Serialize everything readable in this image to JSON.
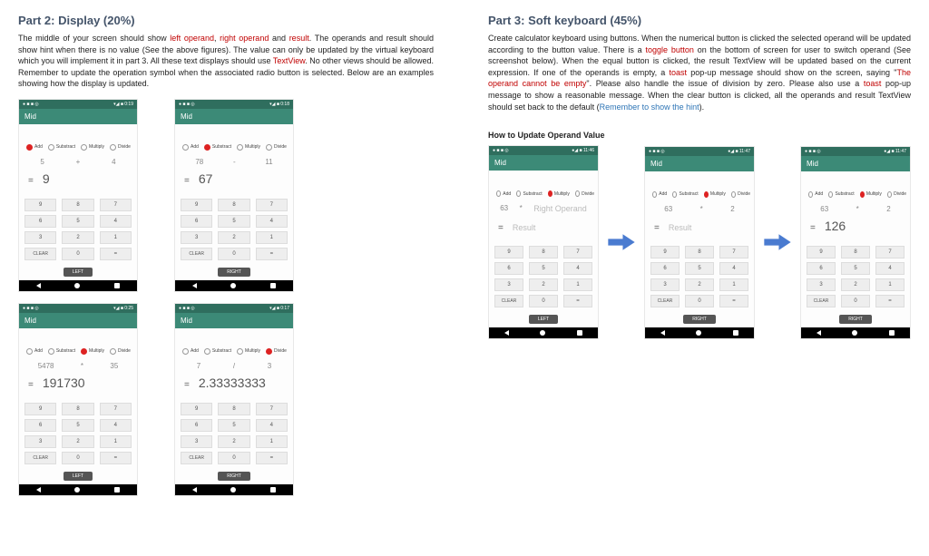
{
  "part2": {
    "title": "Part 2: Display (20%)",
    "text_plain": "The middle of your screen should show ",
    "red1": "left operand",
    "sep1": ", ",
    "red2": "right operand",
    "sep2": " and ",
    "red3": "result",
    "text_after": ". The operands and result should show hint when there is no value (See the above figures). The value can only be updated by the virtual keyboard which you will implement it in part 3. All these text displays should use ",
    "red4": "TextView",
    "text_end": ". No other views should be allowed. Remember to update the operation symbol when the associated radio button is selected. Below are an examples showing how the display is updated."
  },
  "part3": {
    "title": "Part 3: Soft keyboard (45%)",
    "t1": "Create calculator keyboard using buttons. When the numerical button is clicked the selected operand will be updated according to the button value. There is a ",
    "red1": "toggle button",
    "t2": " on the bottom of screen for user to switch operand (See screenshot below). When the equal button is clicked, the result TextView will be updated based on the current expression. If one of the operands is empty, a ",
    "red2": "toast",
    "t3": " pop-up message should show on the screen, saying \"",
    "red3": "The operand cannot be empty",
    "t4": "\". Please also handle the issue of division by zero. Please also use a ",
    "red4": "toast",
    "t5": " pop-up message to show a reasonable message. When the clear button is clicked, all the operands and result TextView should set back to the default (",
    "blue1": "Remember to show the hint",
    "t6": ")."
  },
  "sub_heading": "How to Update Operand Value",
  "status": {
    "left": "● ■ ■ ◎",
    "right": "▾◢ ■ 0:19",
    "right2": "▾◢ ■ 0:18",
    "right3": "▾◢ ■ 0:25",
    "right4": "▾◢ ■ 0:17",
    "rightA": "●◢ ■ 11:46",
    "rightB": "●◢ ■ 11:47",
    "rightC": "●◢ ■ 11:47"
  },
  "app_title": "Mid",
  "radios": {
    "add": "Add",
    "sub": "Substract",
    "mul": "Multiply",
    "div": "Divide"
  },
  "keypad": {
    "r1": [
      "9",
      "8",
      "7"
    ],
    "r2": [
      "6",
      "5",
      "4"
    ],
    "r3": [
      "3",
      "2",
      "1"
    ],
    "r4": [
      "CLEAR",
      "0",
      "="
    ]
  },
  "toggle": {
    "left": "LEFT",
    "right": "RIGHT"
  },
  "phones2": [
    {
      "sel": "add",
      "left": "5",
      "op": "+",
      "right": "4",
      "eq": "=",
      "res": "9",
      "toggle": "LEFT",
      "time": "right"
    },
    {
      "sel": "sub",
      "left": "78",
      "op": "-",
      "right": "11",
      "eq": "=",
      "res": "67",
      "toggle": "RIGHT",
      "time": "right2"
    },
    {
      "sel": "mul",
      "left": "5478",
      "op": "*",
      "right": "35",
      "eq": "=",
      "res": "191730",
      "toggle": "LEFT",
      "time": "right3"
    },
    {
      "sel": "div",
      "left": "7",
      "op": "/",
      "right": "3",
      "eq": "=",
      "res": "2.33333333",
      "toggle": "RIGHT",
      "time": "right4"
    }
  ],
  "phones3": [
    {
      "sel": "mul",
      "left": "63",
      "op": "*",
      "right_hint": "Right Operand",
      "right": "",
      "res_hint": "Result",
      "res": "",
      "toggle": "LEFT",
      "time": "rightA"
    },
    {
      "sel": "mul",
      "left": "63",
      "op": "*",
      "right_hint": "",
      "right": "2",
      "res_hint": "Result",
      "res": "",
      "toggle": "RIGHT",
      "time": "rightB"
    },
    {
      "sel": "mul",
      "left": "63",
      "op": "*",
      "right_hint": "",
      "right": "2",
      "res_hint": "",
      "res": "126",
      "toggle": "RIGHT",
      "time": "rightC"
    }
  ]
}
